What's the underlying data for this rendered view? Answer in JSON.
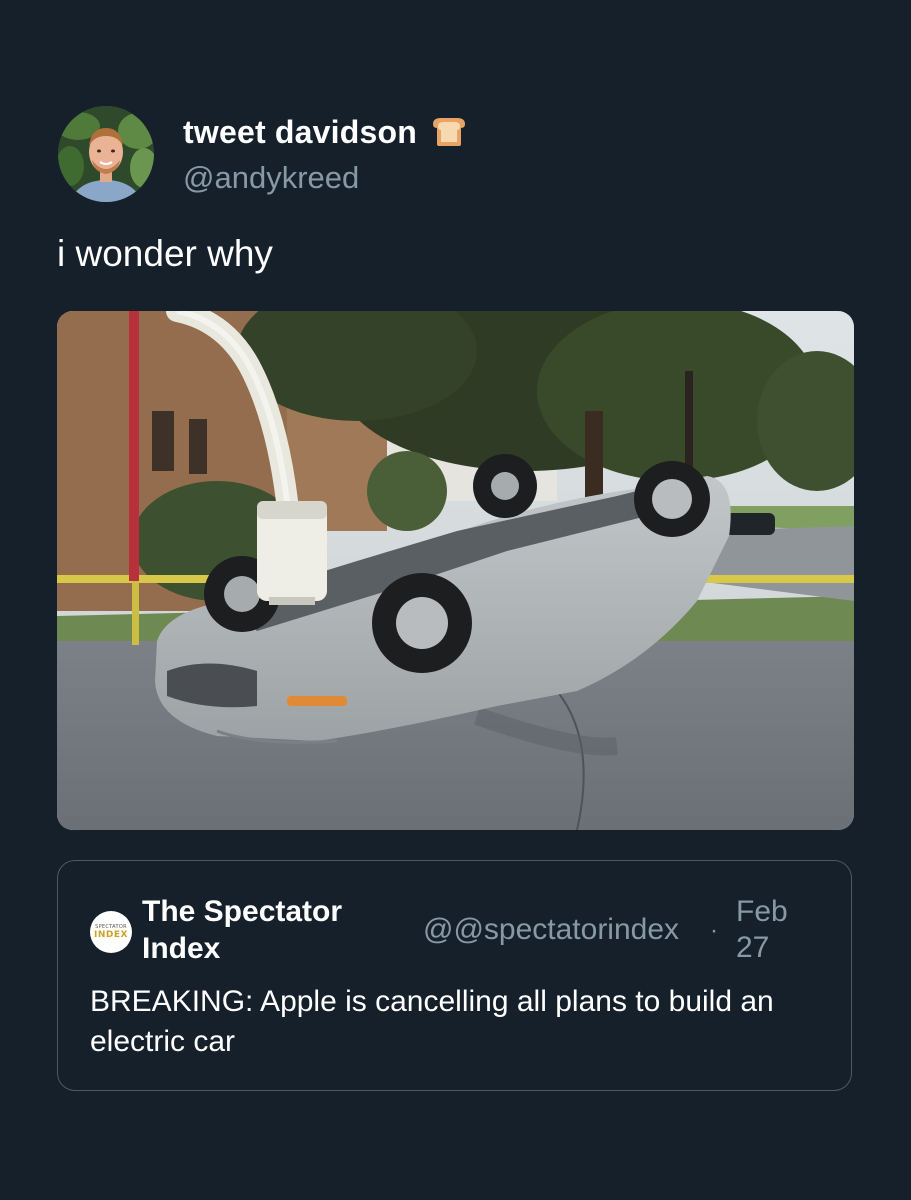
{
  "tweet": {
    "display_name": "tweet davidson",
    "handle": "@andykreed",
    "text": "i wonder why",
    "name_emoji": "bread-icon"
  },
  "quote": {
    "display_name": "The Spectator Index",
    "handle": "@@spectatorindex",
    "separator": "·",
    "date": "Feb 27",
    "text": "BREAKING: Apple is cancelling all plans to build an electric car",
    "avatar_logo_top": "SPECTATOR",
    "avatar_logo_bottom": "INDEX"
  },
  "colors": {
    "background": "#15202b",
    "primary_text": "#ffffff",
    "secondary_text": "#8899a6",
    "card_border": "#4a5a66"
  }
}
